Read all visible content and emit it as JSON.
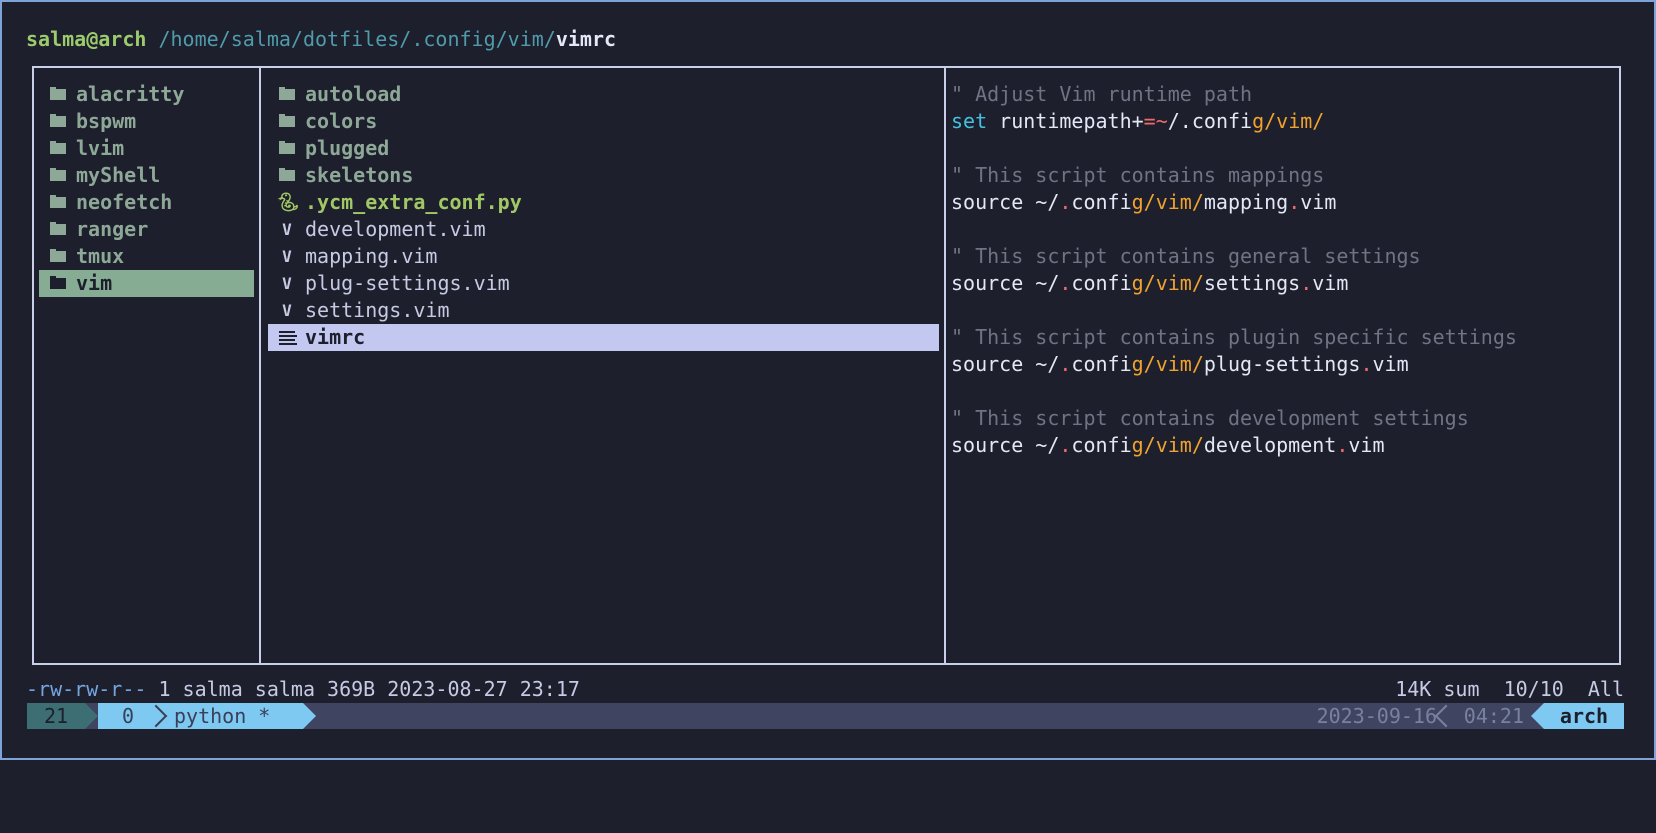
{
  "title_bar": {
    "user_host": "salma@arch",
    "path": " /home/salma/dotfiles/.config/vim/",
    "file": "vimrc"
  },
  "parent_pane": {
    "items": [
      {
        "label": "alacritty",
        "icon": "folder-icon"
      },
      {
        "label": "bspwm",
        "icon": "folder-icon"
      },
      {
        "label": "lvim",
        "icon": "folder-icon"
      },
      {
        "label": "myShell",
        "icon": "folder-icon"
      },
      {
        "label": "neofetch",
        "icon": "folder-icon"
      },
      {
        "label": "ranger",
        "icon": "folder-icon"
      },
      {
        "label": "tmux",
        "icon": "folder-icon"
      },
      {
        "label": "vim",
        "icon": "folder-icon",
        "selected": true
      }
    ]
  },
  "current_pane": {
    "items": [
      {
        "label": "autoload",
        "icon": "folder-icon"
      },
      {
        "label": "colors",
        "icon": "folder-icon"
      },
      {
        "label": "plugged",
        "icon": "folder-icon"
      },
      {
        "label": "skeletons",
        "icon": "folder-icon"
      },
      {
        "label": ".ycm_extra_conf.py",
        "icon": "python-icon"
      },
      {
        "label": "development.vim",
        "icon": "vim-icon"
      },
      {
        "label": "mapping.vim",
        "icon": "vim-icon"
      },
      {
        "label": "plug-settings.vim",
        "icon": "vim-icon"
      },
      {
        "label": "settings.vim",
        "icon": "vim-icon"
      },
      {
        "label": "vimrc",
        "icon": "text-file-icon",
        "selected": true
      }
    ]
  },
  "preview": {
    "comment_1": "\" Adjust Vim runtime path",
    "set_kw": "set",
    "runtimepath": " runtimepath+",
    "eq_tilde": "=~",
    "slash_dot": "/.",
    "confi": "confi",
    "g_vim": "g/vim/",
    "comment_2": "\" This script contains mappings",
    "source": "source ~/",
    "dot": ".",
    "mapping_name": "mapping",
    "vim_ext": "vim",
    "comment_3": "\" This script contains general settings",
    "settings_name": "settings",
    "comment_4": "\" This script contains plugin specific settings",
    "plug_settings_name": "plug-settings",
    "comment_5": "\" This script contains development settings",
    "development_name": "development"
  },
  "status": {
    "permissions": "-rw-rw-r--",
    "details": " 1 salma salma 369B 2023-08-27 23:17",
    "right": "14K sum  10/10  All"
  },
  "tmux": {
    "session": "21",
    "window_index": "0",
    "window_name": "python *",
    "date": "2023-09-16",
    "time": "04:21",
    "host": "arch"
  },
  "colors": {
    "accent_blue": "#7dc9f1",
    "folder_green": "#8ea897",
    "python_green": "#a2c866",
    "selection_lavender": "#c3c8f0",
    "directory_orange": "#f0a22e"
  }
}
